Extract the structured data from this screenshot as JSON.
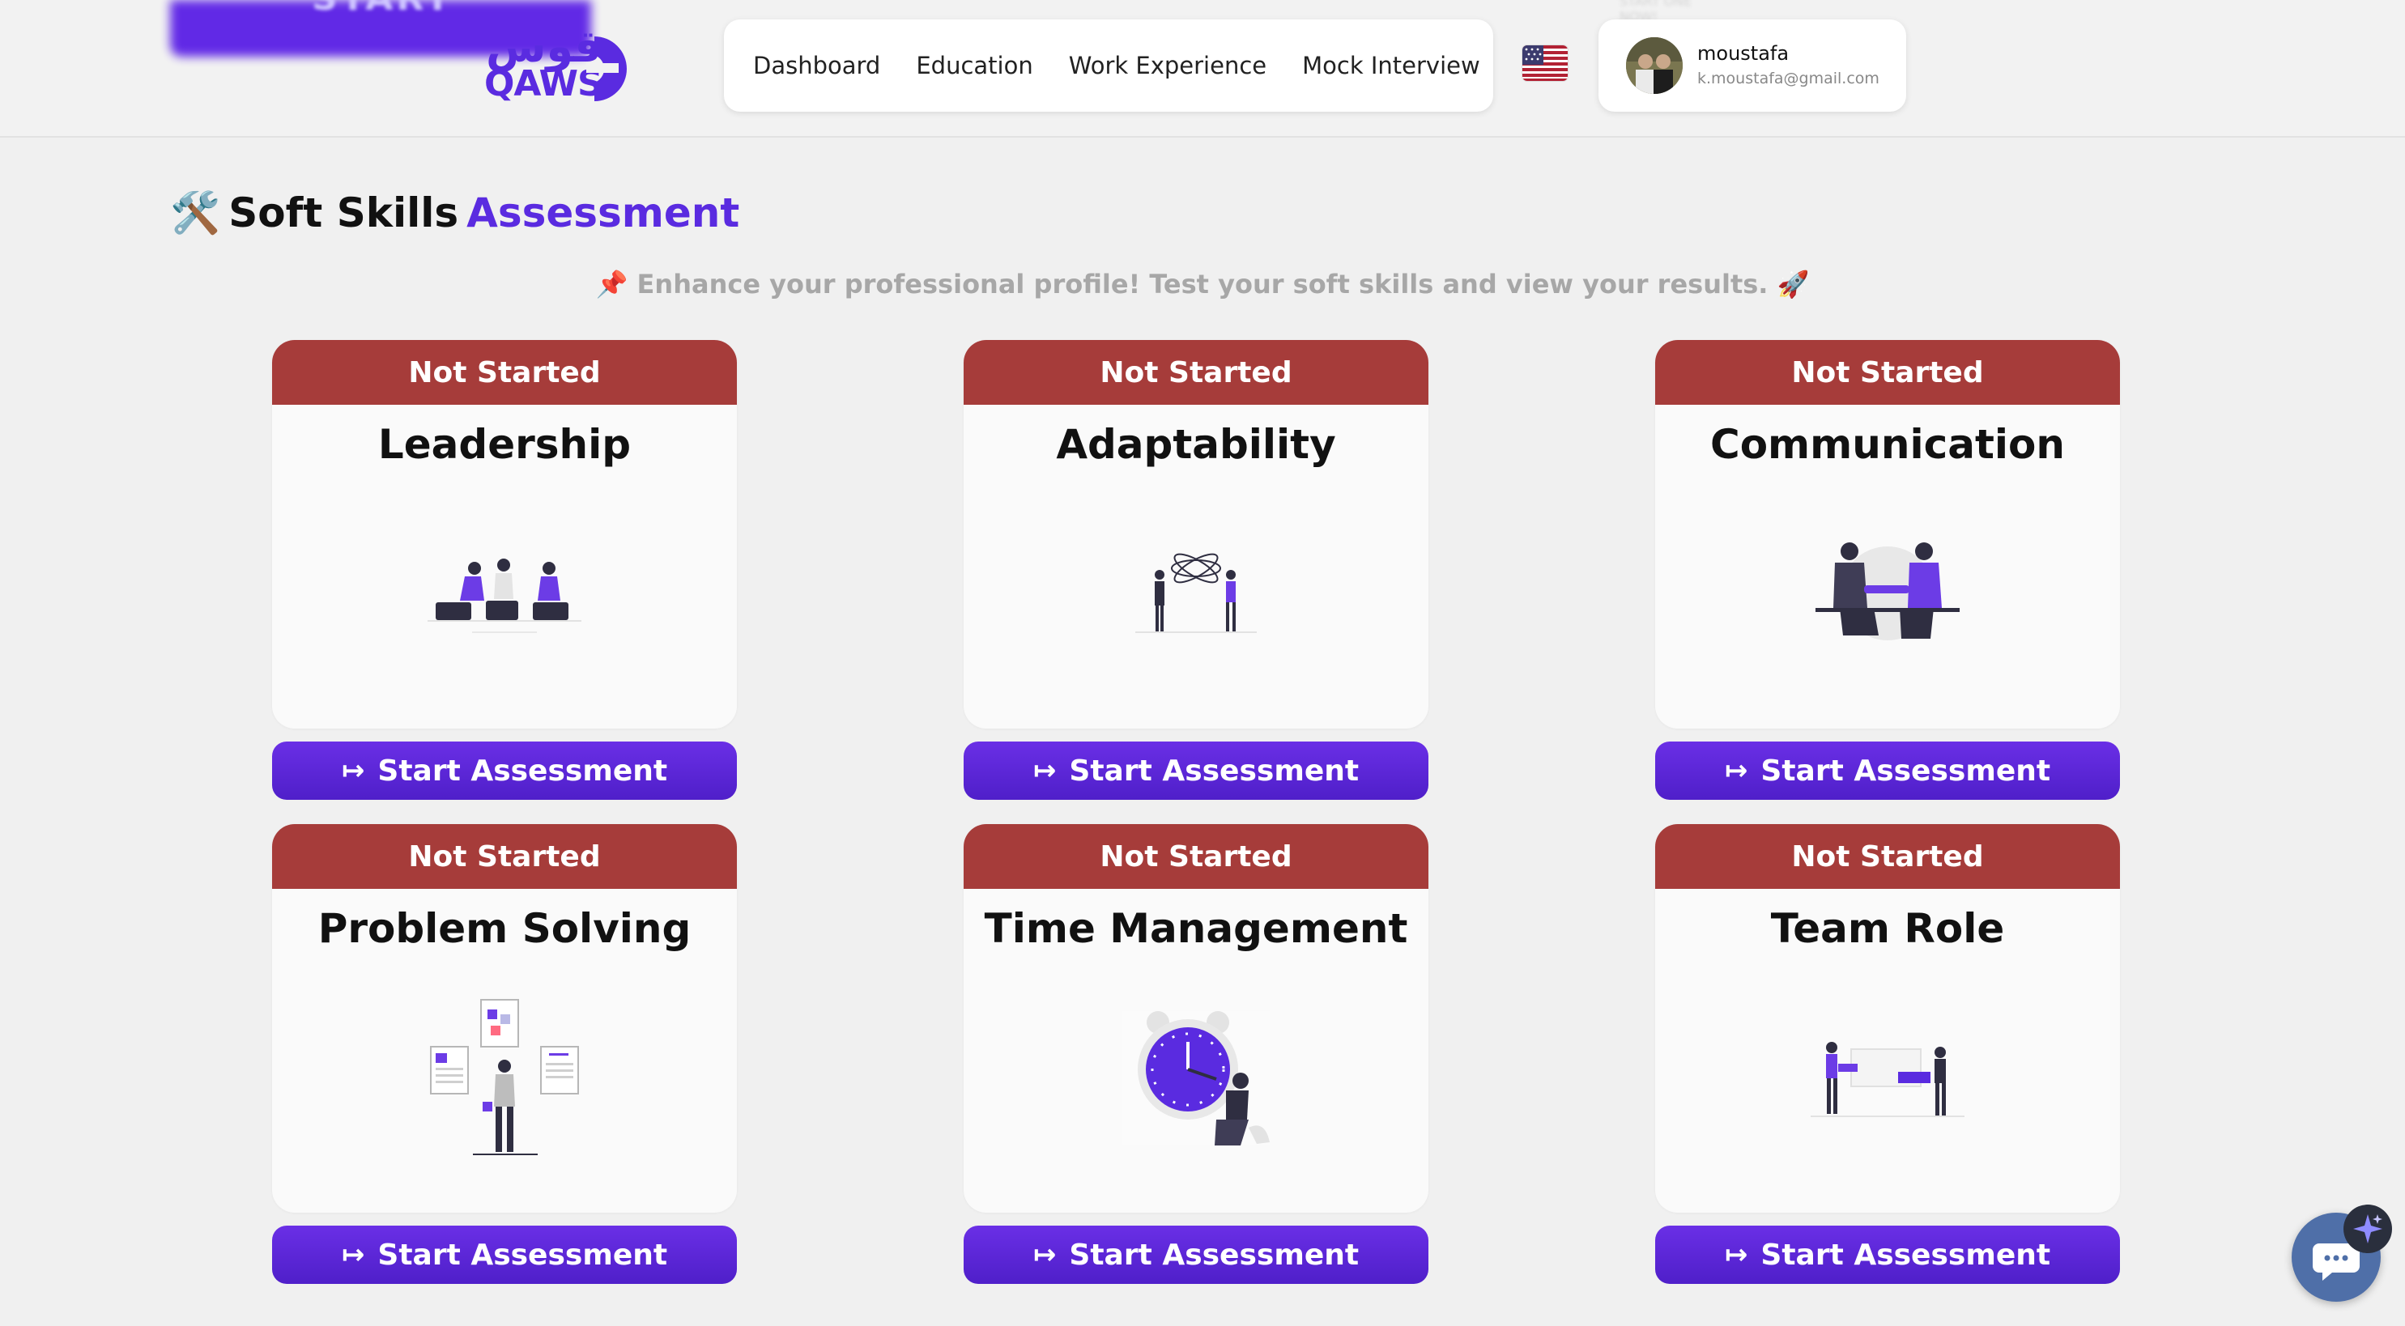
{
  "promo": {
    "label": "START",
    "ghost": "START ONE NOW!"
  },
  "logo": {
    "arabic": "قوس",
    "latin": "QAWS"
  },
  "nav": {
    "items": [
      {
        "label": "Dashboard"
      },
      {
        "label": "Education"
      },
      {
        "label": "Work Experience"
      },
      {
        "label": "Mock Interview"
      }
    ]
  },
  "language": {
    "flag": "us-flag-icon"
  },
  "profile": {
    "name": "moustafa",
    "email": "k.moustafa@gmail.com"
  },
  "page": {
    "title_emoji": "🛠️",
    "title_main": "Soft Skills",
    "title_accent": "Assessment",
    "subtitle": "📌 Enhance your professional profile! Test your soft skills and view your results. 🚀"
  },
  "cards": [
    {
      "status": "Not Started",
      "title": "Leadership",
      "illustration": "team-meeting-illustration",
      "button": "Start Assessment"
    },
    {
      "status": "Not Started",
      "title": "Adaptability",
      "illustration": "orbit-people-illustration",
      "button": "Start Assessment"
    },
    {
      "status": "Not Started",
      "title": "Communication",
      "illustration": "handshake-illustration",
      "button": "Start Assessment"
    },
    {
      "status": "Not Started",
      "title": "Problem Solving",
      "illustration": "documents-person-illustration",
      "button": "Start Assessment"
    },
    {
      "status": "Not Started",
      "title": "Time Management",
      "illustration": "clock-person-illustration",
      "button": "Start Assessment"
    },
    {
      "status": "Not Started",
      "title": "Team Role",
      "illustration": "collaboration-illustration",
      "button": "Start Assessment"
    }
  ],
  "colors": {
    "accent": "#5a2be0",
    "status_bg": "#a63c3a",
    "button_bg": "#5a23d6",
    "background": "#f0f0f0"
  }
}
